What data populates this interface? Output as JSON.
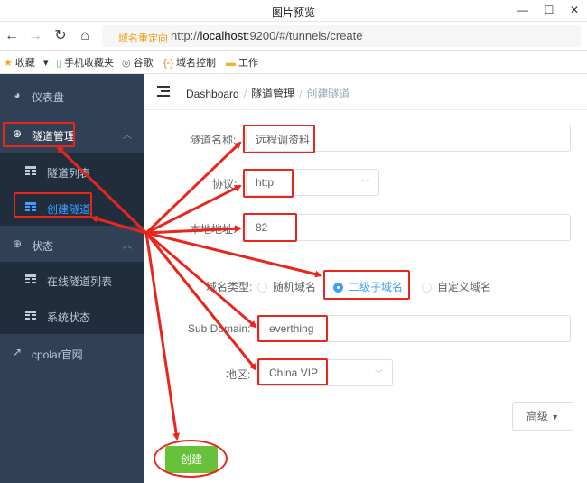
{
  "window": {
    "title": "图片预览",
    "minimize": "—",
    "maximize": "☐",
    "close": "✕"
  },
  "browser": {
    "redirect_label": "域名重定向",
    "url_prefix": "http://",
    "url_host": "localhost",
    "url_rest": ":9200/#/tunnels/create"
  },
  "bookmarks": [
    {
      "icon": "star-icon",
      "label": "收藏",
      "dropdown": "▾"
    },
    {
      "icon": "phone-icon",
      "label": "手机收藏夹"
    },
    {
      "icon": "globe-icon",
      "label": "谷歌"
    },
    {
      "icon": "bracket-icon",
      "label": "域名控制"
    },
    {
      "icon": "folder-icon",
      "label": "工作"
    }
  ],
  "sidebar": {
    "dashboard": "仪表盘",
    "tunnel_mgmt": "隧道管理",
    "tunnel_list": "隧道列表",
    "create_tunnel": "创建隧道",
    "status": "状态",
    "online_tunnels": "在线隧道列表",
    "system_status": "系统状态",
    "cpolar_site": "cpolar官网"
  },
  "breadcrumb": {
    "home": "Dashboard",
    "section": "隧道管理",
    "current": "创建隧道",
    "separator": "/"
  },
  "form": {
    "name_label": "隧道名称:",
    "name_value": "远程调资料",
    "protocol_label": "协议:",
    "protocol_value": "http",
    "local_addr_label": "本地地址:",
    "local_addr_value": "82",
    "domain_type_label": "域名类型:",
    "domain_options": [
      "随机域名",
      "二级子域名",
      "自定义域名"
    ],
    "subdomain_label": "Sub Domain:",
    "subdomain_value": "everthing",
    "region_label": "地区:",
    "region_value": "China VIP",
    "advanced": "高级",
    "create": "创建"
  },
  "colors": {
    "sidebar_bg": "#304156",
    "submenu_bg": "#1f2d3d",
    "accent": "#409eff",
    "success": "#67c23a",
    "annotation": "#e8261c"
  }
}
